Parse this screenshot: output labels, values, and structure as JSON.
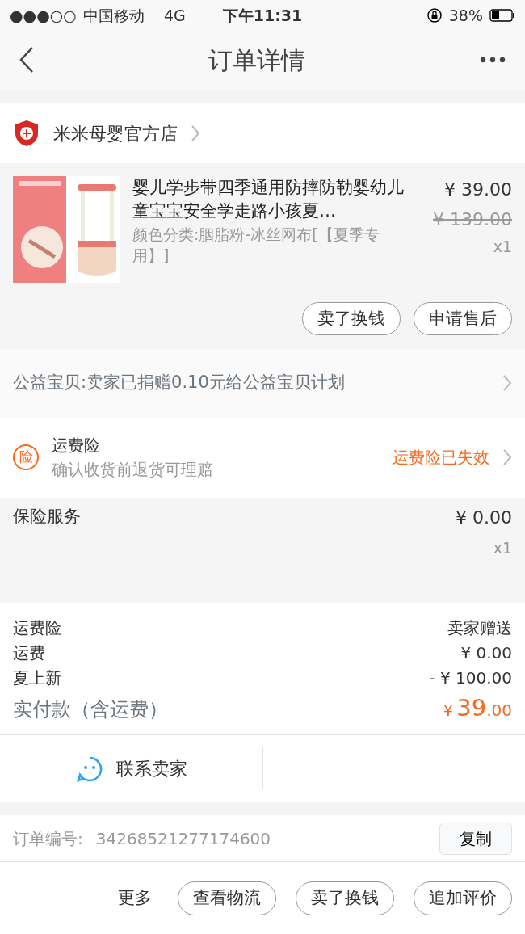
{
  "status_bar": {
    "signal": "●●●○○",
    "carrier": "中国移动",
    "network": "4G",
    "time": "下午11:31",
    "battery": "38%"
  },
  "nav": {
    "title": "订单详情"
  },
  "store": {
    "name": "米米母婴官方店"
  },
  "product": {
    "image": {
      "kind": "picture"
    },
    "title": "婴儿学步带四季通用防摔防勒婴幼儿童宝宝安全学走路小孩夏…",
    "variant": "颜色分类:胭脂粉-冰丝网布[【夏季专用】]",
    "price": "¥ 39.00",
    "original_price": "¥ 139.00",
    "quantity": "x1",
    "buttons": [
      "卖了换钱",
      "申请售后"
    ]
  },
  "charity": {
    "text": "公益宝贝:卖家已捐赠0.10元给公益宝贝计划"
  },
  "shipping_insurance": {
    "badge": "险",
    "title": "运费险",
    "subtitle": "确认收货前退货可理赔",
    "status": "运费险已失效"
  },
  "insurance_service": {
    "title": "保险服务",
    "price": "¥ 0.00",
    "quantity": "x1"
  },
  "fees": [
    {
      "label": "运费险",
      "value": "卖家赠送"
    },
    {
      "label": "运费",
      "value": "¥ 0.00"
    },
    {
      "label": "夏上新",
      "value": "- ¥ 100.00"
    }
  ],
  "total": {
    "label": "实付款（含运费）",
    "currency": "¥",
    "integer": "39",
    "decimal": ".00"
  },
  "contact": {
    "label": "联系卖家"
  },
  "order": {
    "label": "订单编号:",
    "number": "34268521277174600",
    "copy_button": "复制"
  },
  "bottom_bar": {
    "more": "更多",
    "buttons": [
      "查看物流",
      "卖了换钱",
      "追加评价"
    ]
  }
}
